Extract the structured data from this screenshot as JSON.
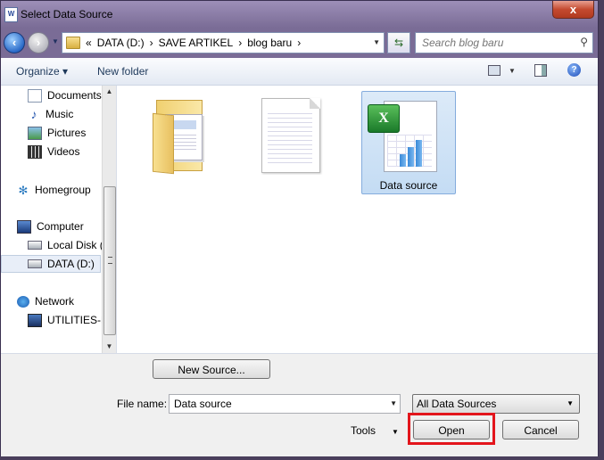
{
  "window": {
    "title": "Select Data Source",
    "app_icon": "W",
    "close_label": "x"
  },
  "nav": {
    "breadcrumbs": [
      "«",
      "DATA (D:)",
      "›",
      "SAVE ARTIKEL",
      "›",
      "blog baru",
      "›"
    ],
    "search_placeholder": "Search blog baru"
  },
  "toolbar": {
    "organize": "Organize ▾",
    "new_folder": "New folder"
  },
  "sidebar": {
    "items": [
      {
        "label": "Documents",
        "icon": "documents-icon"
      },
      {
        "label": "Music",
        "icon": "music-icon"
      },
      {
        "label": "Pictures",
        "icon": "pictures-icon"
      },
      {
        "label": "Videos",
        "icon": "videos-icon"
      },
      {
        "label": "Homegroup",
        "icon": "homegroup-icon"
      },
      {
        "label": "Computer",
        "icon": "computer-icon"
      },
      {
        "label": "Local Disk (",
        "icon": "disk-icon"
      },
      {
        "label": "DATA (D:)",
        "icon": "disk-icon"
      },
      {
        "label": "Network",
        "icon": "network-icon"
      },
      {
        "label": "UTILITIES-D",
        "icon": "pc-icon"
      }
    ]
  },
  "files": [
    {
      "label": "",
      "icon": "folder-icon"
    },
    {
      "label": "",
      "icon": "text-file-icon"
    },
    {
      "label": "Data source",
      "icon": "excel-file-icon",
      "selected": true
    }
  ],
  "bottom": {
    "new_source": "New Source...",
    "file_name_label": "File name:",
    "file_name_value": "Data source",
    "filter_value": "All Data Sources",
    "tools_label": "Tools",
    "open_label": "Open",
    "cancel_label": "Cancel"
  },
  "colors": {
    "highlight": "#e3151c",
    "selection": "#c4dcf4"
  }
}
